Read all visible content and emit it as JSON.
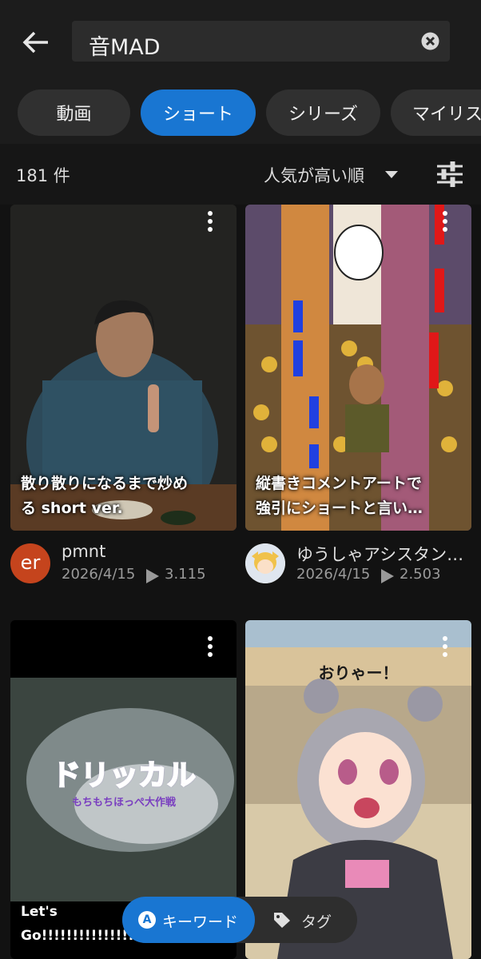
{
  "header": {
    "back_icon": "arrow-left-icon",
    "search": {
      "value": "音MAD",
      "clear_icon": "clear-circle-icon"
    }
  },
  "tabs": [
    {
      "label": "動画",
      "active": false
    },
    {
      "label": "ショート",
      "active": true
    },
    {
      "label": "シリーズ",
      "active": false
    },
    {
      "label": "マイリスト",
      "active": false
    }
  ],
  "results": {
    "count": "181 件",
    "sort_label": "人気が高い順",
    "sort_icon": "caret-down-icon",
    "filter_icon": "tune-sliders-icon"
  },
  "videos": [
    {
      "caption": "散り散りになるまで炒め\nる short ver.",
      "author": "pmnt",
      "avatar_text": "er",
      "date": "2026/4/15",
      "views": "3.115"
    },
    {
      "caption": "縦書きコメントアートで\n強引にショートと言い…",
      "author": "ゆうしゃアシスタン…",
      "avatar_text": "",
      "date": "2026/4/15",
      "views": "2.503"
    },
    {
      "caption": "Let's\nGo!!!!!!!!!!!!!!!!!!!",
      "thumb_logo": "ドリッカル",
      "thumb_logo_sub": "もちもちほっぺ大作戦",
      "author": "",
      "date": "",
      "views": ""
    },
    {
      "caption": "",
      "thumb_text": "おりゃー！",
      "author": "",
      "date": "",
      "views": ""
    }
  ],
  "bottom_switch": {
    "keyword_label": "キーワード",
    "keyword_icon": "letter-a-icon",
    "tag_label": "タグ",
    "tag_icon": "tag-icon"
  },
  "colors": {
    "accent": "#1976d2",
    "background": "#121212",
    "chip": "#303030"
  }
}
